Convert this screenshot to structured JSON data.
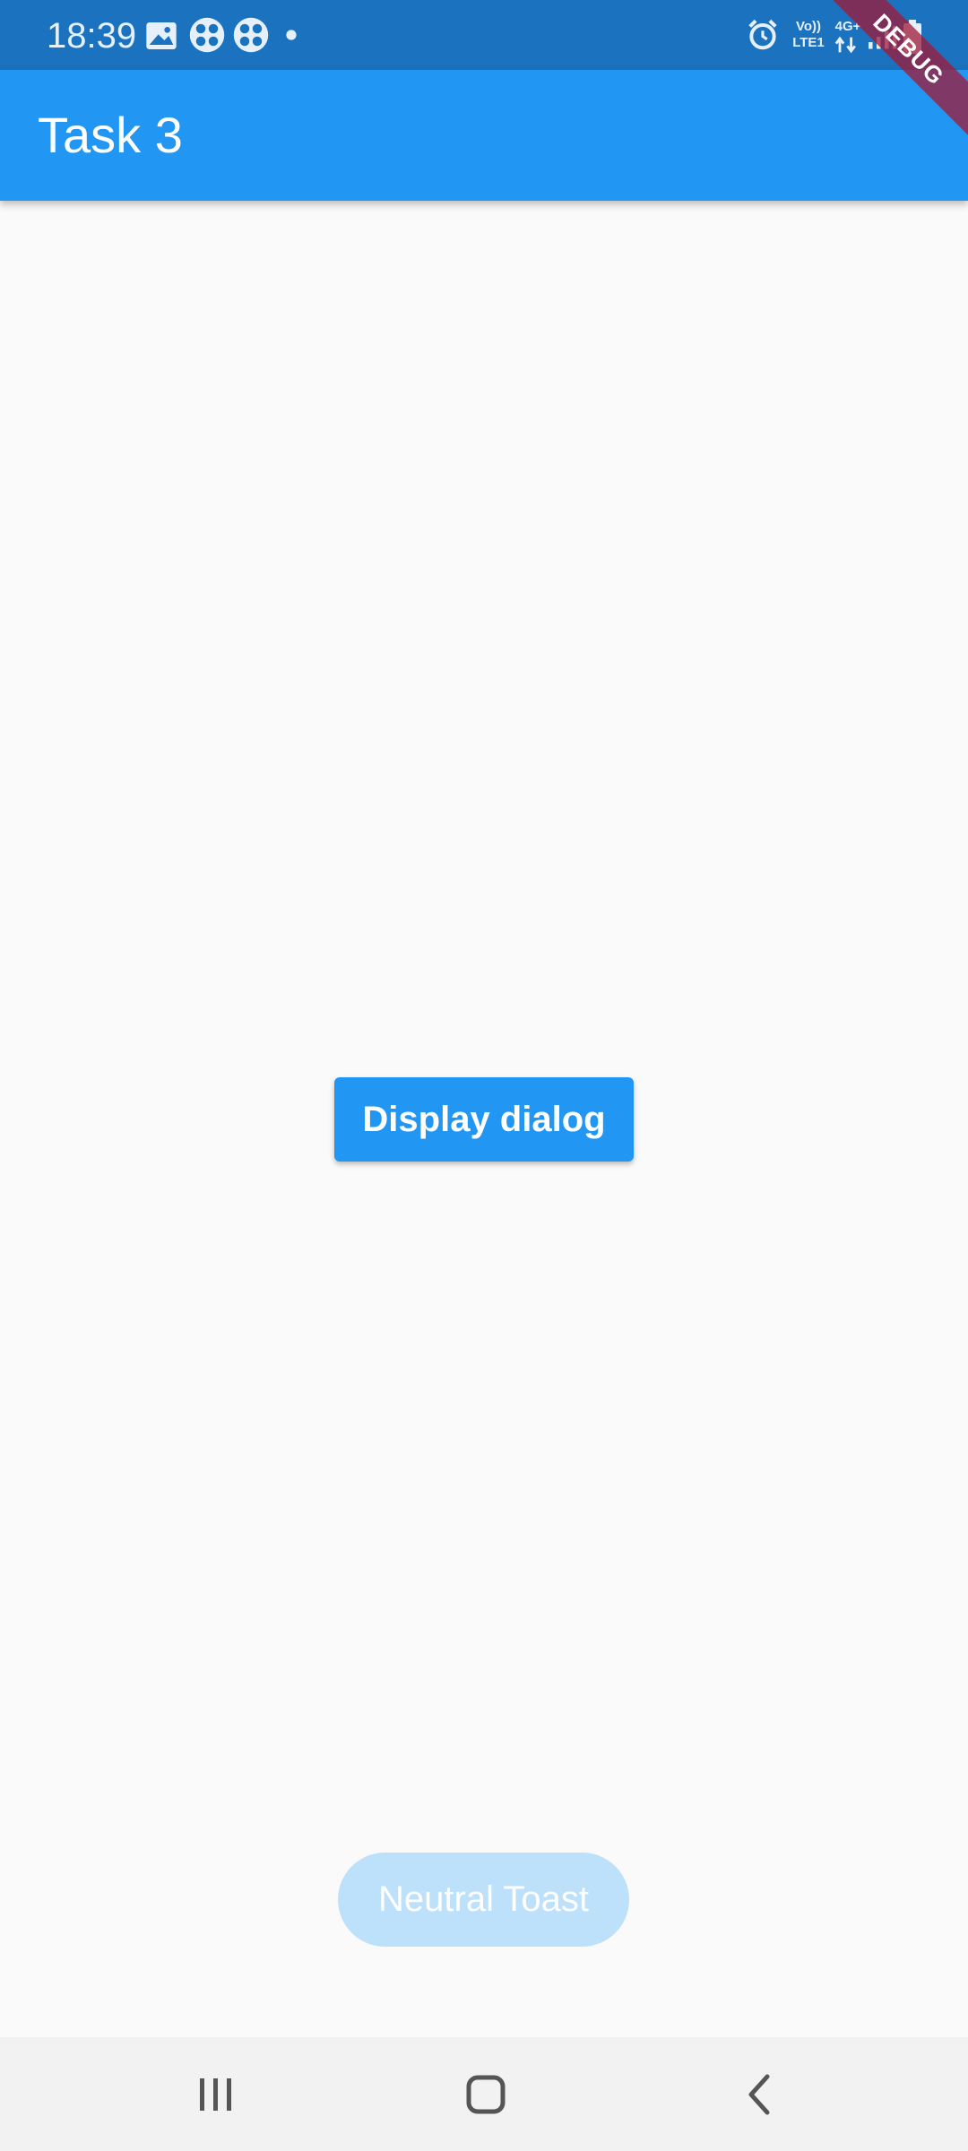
{
  "status_bar": {
    "time": "18:39",
    "volte_top": "Vo))",
    "volte_bottom": "LTE1",
    "network_type": "4G+",
    "icons": [
      "image-icon",
      "pinwheel-icon",
      "pinwheel-icon",
      "dot-icon",
      "alarm-icon",
      "signal-icon",
      "battery-icon"
    ]
  },
  "app_bar": {
    "title": "Task 3"
  },
  "debug_banner": {
    "label": "DEBUG"
  },
  "main": {
    "display_dialog_label": "Display dialog"
  },
  "toast": {
    "message": "Neutral Toast"
  },
  "nav_bar": {
    "icons": [
      "recents-icon",
      "home-icon",
      "back-icon"
    ]
  },
  "colors": {
    "status_bar": "#1b72bf",
    "primary": "#2196f3",
    "background": "#fafafa",
    "toast": "#bde0fb",
    "nav_bar": "#f2f2f2"
  }
}
